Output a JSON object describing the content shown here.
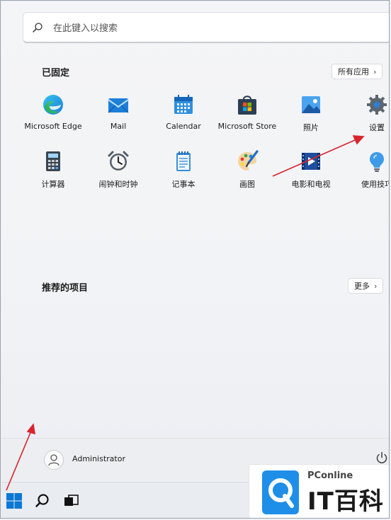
{
  "search": {
    "placeholder": "在此键入以搜索"
  },
  "pinned": {
    "title": "已固定",
    "all_apps_label": "所有应用",
    "apps": [
      {
        "label": "Microsoft Edge",
        "icon": "edge-icon"
      },
      {
        "label": "Mail",
        "icon": "mail-icon"
      },
      {
        "label": "Calendar",
        "icon": "calendar-icon"
      },
      {
        "label": "Microsoft Store",
        "icon": "store-icon"
      },
      {
        "label": "照片",
        "icon": "photos-icon"
      },
      {
        "label": "设置",
        "icon": "gear-icon"
      },
      {
        "label": "计算器",
        "icon": "calculator-icon"
      },
      {
        "label": "闹钟和时钟",
        "icon": "alarm-clock-icon"
      },
      {
        "label": "记事本",
        "icon": "notepad-icon"
      },
      {
        "label": "画图",
        "icon": "paint-icon"
      },
      {
        "label": "电影和电视",
        "icon": "movies-tv-icon"
      },
      {
        "label": "使用技巧",
        "icon": "tips-icon"
      }
    ]
  },
  "recommended": {
    "title": "推荐的项目",
    "more_label": "更多"
  },
  "user": {
    "name": "Administrator"
  },
  "watermark": {
    "brand_top": "PConline",
    "brand_main": "IT百科"
  },
  "colors": {
    "accent": "#0067c0",
    "arrow": "#d8242c"
  }
}
